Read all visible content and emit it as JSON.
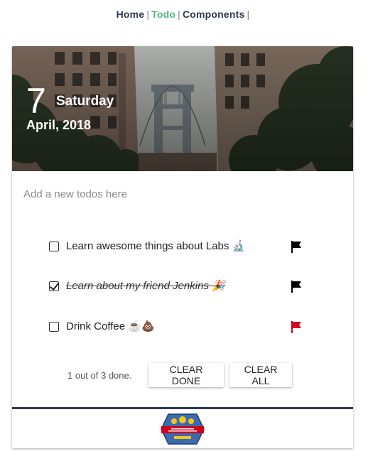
{
  "nav": {
    "items": [
      {
        "label": "Home",
        "active": false
      },
      {
        "label": "Todo",
        "active": true
      },
      {
        "label": "Components",
        "active": false
      }
    ],
    "separator": "|"
  },
  "header": {
    "day": "7",
    "weekday": "Saturday",
    "month_year": "April, 2018"
  },
  "new_todo": {
    "placeholder": "Add a new todos here",
    "value": ""
  },
  "todos": [
    {
      "text": "Learn awesome things about Labs 🔬",
      "done": false,
      "flag_color": "#000000"
    },
    {
      "text": "Learn about my friend Jenkins 🎉",
      "done": true,
      "flag_color": "#000000"
    },
    {
      "text": "Drink Coffee ☕💩",
      "done": false,
      "flag_color": "#d0021b"
    }
  ],
  "footer": {
    "status": "1 out of 3 done.",
    "clear_done_label": "CLEAR DONE",
    "clear_all_label": "CLEAR ALL"
  },
  "colors": {
    "nav_active": "#52b97a",
    "nav_text": "#2e3a4f",
    "flag_important": "#d0021b",
    "divider": "#2e3a4f"
  },
  "icons": {
    "flag": "flag-icon",
    "logo": "open-innovation-labs-logo"
  }
}
